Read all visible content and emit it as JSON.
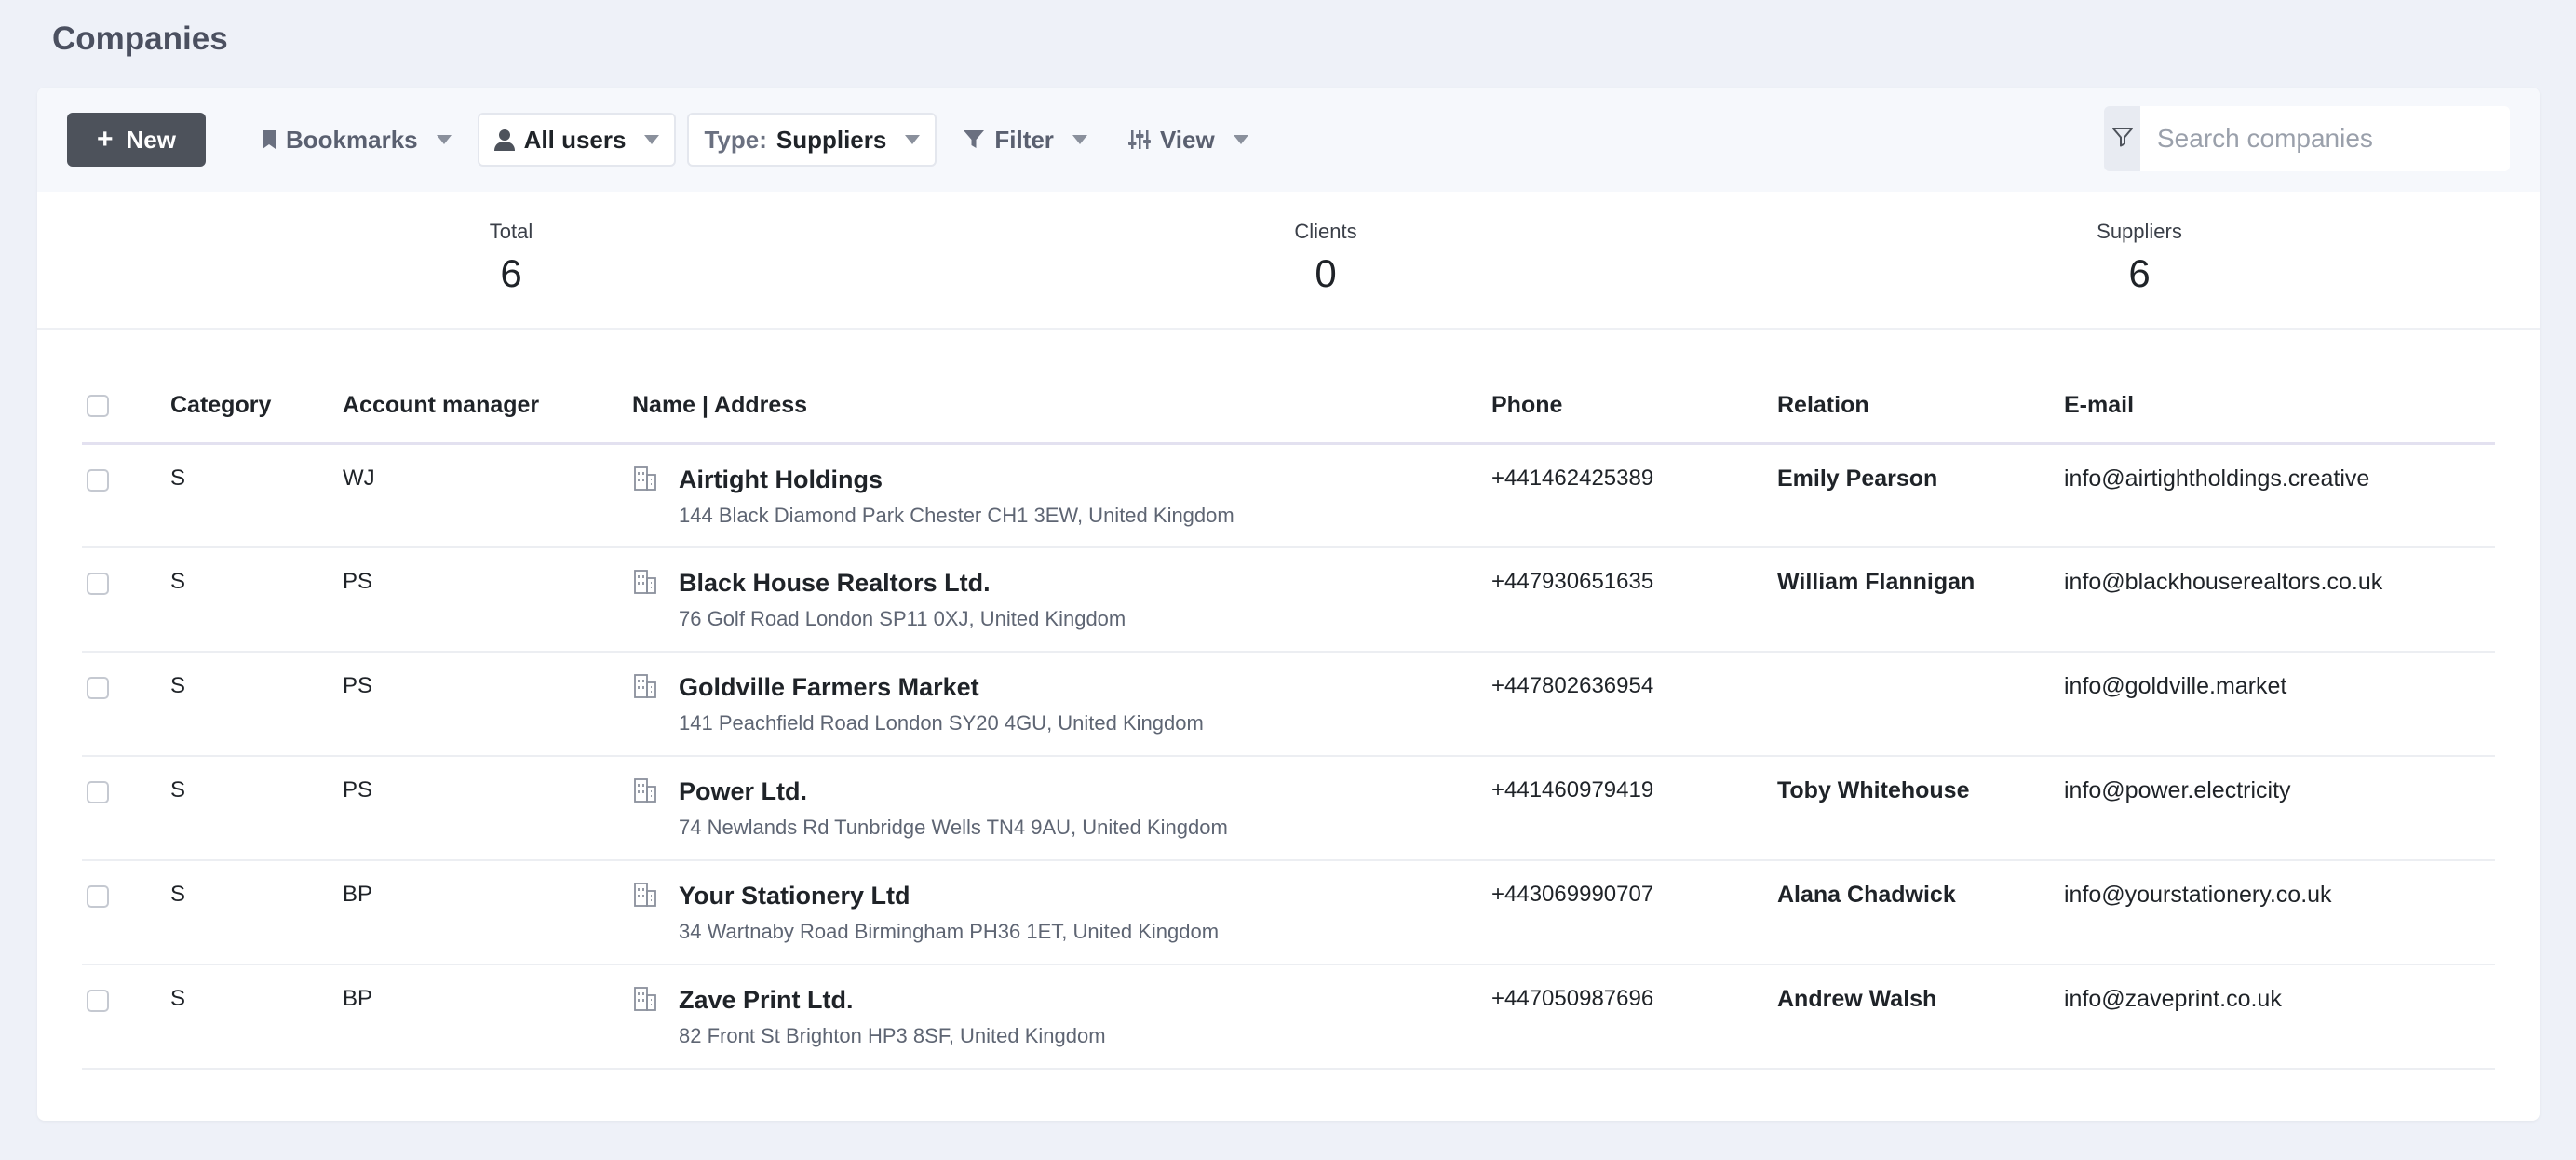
{
  "page": {
    "title": "Companies"
  },
  "toolbar": {
    "new_label": "New",
    "bookmarks_label": "Bookmarks",
    "users_label": "All users",
    "type_prefix": "Type:",
    "type_value": "Suppliers",
    "filter_label": "Filter",
    "view_label": "View"
  },
  "search": {
    "placeholder": "Search companies",
    "value": ""
  },
  "stats": {
    "total": {
      "label": "Total",
      "value": "6"
    },
    "clients": {
      "label": "Clients",
      "value": "0"
    },
    "suppliers": {
      "label": "Suppliers",
      "value": "6"
    }
  },
  "table": {
    "headers": {
      "category": "Category",
      "manager": "Account manager",
      "name": "Name | Address",
      "phone": "Phone",
      "relation": "Relation",
      "email": "E-mail"
    },
    "rows": [
      {
        "category": "S",
        "manager": "WJ",
        "name": "Airtight Holdings",
        "address": "144 Black Diamond Park Chester CH1 3EW, United Kingdom",
        "phone": "+441462425389",
        "relation": "Emily Pearson",
        "email": "info@airtightholdings.creative"
      },
      {
        "category": "S",
        "manager": "PS",
        "name": "Black House Realtors Ltd.",
        "address": "76 Golf Road London SP11 0XJ, United Kingdom",
        "phone": "+447930651635",
        "relation": "William Flannigan",
        "email": "info@blackhouserealtors.co.uk"
      },
      {
        "category": "S",
        "manager": "PS",
        "name": "Goldville Farmers Market",
        "address": "141 Peachfield Road London SY20 4GU, United Kingdom",
        "phone": "+447802636954",
        "relation": "",
        "email": "info@goldville.market"
      },
      {
        "category": "S",
        "manager": "PS",
        "name": "Power Ltd.",
        "address": "74 Newlands Rd Tunbridge Wells TN4 9AU, United Kingdom",
        "phone": "+441460979419",
        "relation": "Toby Whitehouse",
        "email": "info@power.electricity"
      },
      {
        "category": "S",
        "manager": "BP",
        "name": "Your Stationery Ltd",
        "address": "34 Wartnaby Road Birmingham PH36 1ET, United Kingdom",
        "phone": "+443069990707",
        "relation": "Alana Chadwick",
        "email": "info@yourstationery.co.uk"
      },
      {
        "category": "S",
        "manager": "BP",
        "name": "Zave Print Ltd.",
        "address": "82 Front St Brighton HP3 8SF, United Kingdom",
        "phone": "+447050987696",
        "relation": "Andrew Walsh",
        "email": "info@zaveprint.co.uk"
      }
    ]
  }
}
